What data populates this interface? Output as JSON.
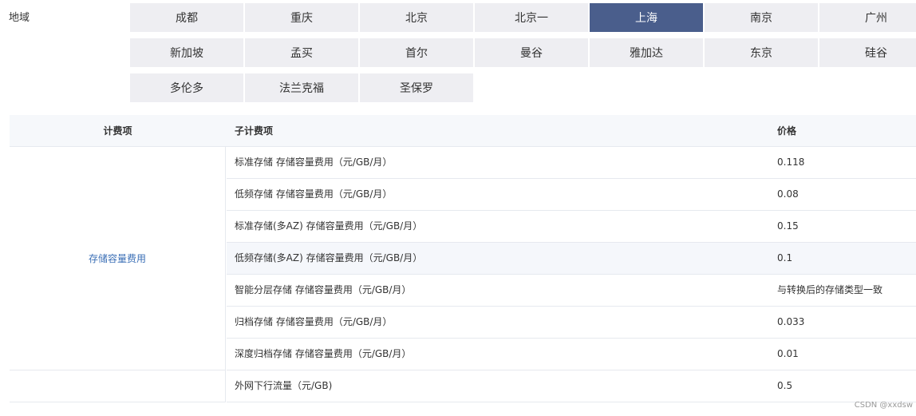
{
  "region": {
    "label": "地域",
    "options": [
      "成都",
      "重庆",
      "北京",
      "北京一",
      "上海",
      "南京",
      "广州",
      "新加坡",
      "孟买",
      "首尔",
      "曼谷",
      "雅加达",
      "东京",
      "硅谷",
      "多伦多",
      "法兰克福",
      "圣保罗"
    ],
    "selected": "上海"
  },
  "table": {
    "headers": {
      "item": "计费项",
      "sub_item": "子计费项",
      "price": "价格"
    },
    "group": {
      "label": "存储容量费用",
      "rows": [
        {
          "sub_item": "标准存储 存储容量费用（元/GB/月）",
          "price": "0.118"
        },
        {
          "sub_item": "低频存储 存储容量费用（元/GB/月）",
          "price": "0.08"
        },
        {
          "sub_item": "标准存储(多AZ) 存储容量费用（元/GB/月）",
          "price": "0.15"
        },
        {
          "sub_item": "低频存储(多AZ) 存储容量费用（元/GB/月）",
          "price": "0.1"
        },
        {
          "sub_item": "智能分层存储 存储容量费用（元/GB/月）",
          "price": "与转换后的存储类型一致"
        },
        {
          "sub_item": "归档存储 存储容量费用（元/GB/月）",
          "price": "0.033"
        },
        {
          "sub_item": "深度归档存储 存储容量费用（元/GB/月）",
          "price": "0.01"
        }
      ]
    },
    "extra_row": {
      "sub_item": "外网下行流量（元/GB)",
      "price": "0.5"
    }
  },
  "watermark": "CSDN @xxdsw",
  "colors": {
    "selected_bg": "#4a5e8c",
    "button_bg": "#eeeef2",
    "link": "#3b6fb6",
    "header_bg": "#f6f8fb"
  }
}
